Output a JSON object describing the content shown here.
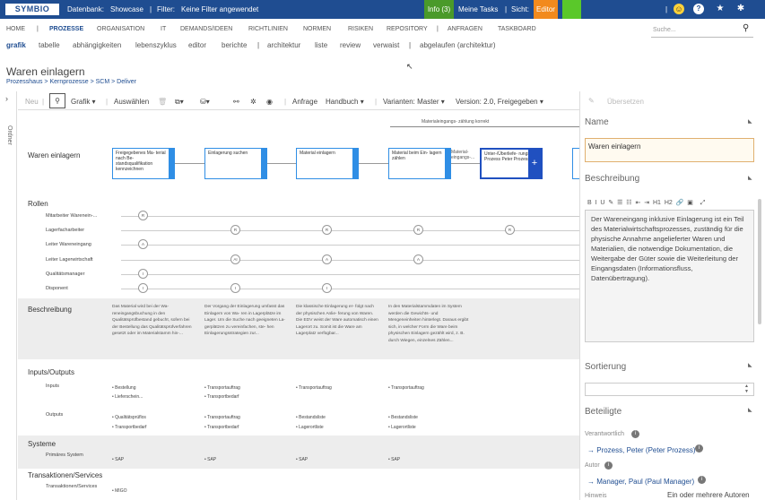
{
  "topbar": {
    "logo": "SYMBIO",
    "db_label": "Datenbank:",
    "db_value": "Showcase",
    "sep1": "|",
    "filter_label": "Filter:",
    "filter_value": "Keine Filter angewendet",
    "info": "Info (3)",
    "tasks": "Meine Tasks",
    "sep2": "|",
    "view_label": "Sicht:",
    "view_value": "Editor",
    "sep3": "|",
    "icons": [
      "smiley-icon",
      "help-icon",
      "star-icon",
      "gear-icon"
    ],
    "colors": {
      "bar": "#1f4d91",
      "info": "#4a9a2a",
      "editor": "#f28a1d",
      "green": "#5ac82a"
    }
  },
  "mainnav": {
    "items": [
      "HOME",
      "|",
      "PROZESSE",
      "ORGANISATION",
      "IT",
      "DEMANDS/IDEEN",
      "RICHTLINIEN",
      "NORMEN",
      "RISIKEN",
      "REPOSITORY",
      "|",
      "ANFRAGEN",
      "TASKBOARD"
    ],
    "search_placeholder": "Suche..."
  },
  "subnav": {
    "items": [
      "grafik",
      "tabelle",
      "abhängigkeiten",
      "lebenszyklus",
      "editor",
      "berichte",
      "|",
      "architektur",
      "liste",
      "review",
      "verwaist",
      "|",
      "abgelaufen (architektur)"
    ]
  },
  "page": {
    "title": "Waren einlagern",
    "breadcrumb": "Prozesshaus > Kernprozesse > SCM > Deliver"
  },
  "leftstrip": {
    "label": "Ordner"
  },
  "toolbar": {
    "new": "Neu",
    "sep1": "|",
    "graphic": "Grafik ▾",
    "sep2": "|",
    "select": "Auswählen",
    "request": "Anfrage",
    "manual": "Handbuch ▾",
    "sep3": "|",
    "variants": "Varianten: Master ▾",
    "version": "Version: 2.0, Freigegeben ▾"
  },
  "diagram": {
    "process_label": "Waren einlagern",
    "top_annotation": "Materialeingangs- zählung korrekt",
    "steps": [
      "Freigegebenes Ma- terial nach Be- standsqualifikation kennzeichnen",
      "Einlagerung suchen",
      "Material einlagern",
      "Material beim Ein- lagern zählen",
      "Unter-/Überliefe- rungs- Prozess Peter Prozess"
    ],
    "arrow_label": "Material- eingangs-...",
    "roles_title": "Rollen",
    "roles": [
      "Mitarbeiter Warenein-...",
      "Lagerfacharbeiter",
      "Leiter Wareneingang",
      "Leiter Lagerwirtschaft",
      "Qualitätsmanager",
      "Disponent"
    ],
    "desc_title": "Beschreibung",
    "descriptions": [
      "Das Material wird bei der Wa- reneingangsbuchung in den Qualitätsprüfbestand gebucht, sofern bei der Bestellung das Qualitätsprüfverfahren gesetzt oder im Materialstamm hin-...",
      "Der Vorgang der Einlagerung umfasst das Einlagern von Wa- ren in Lagerplätze im Lager. Um die Suche nach geeigneten La- gerplätzen zu vereinfachen, ste- hen Einlagerungsstrategien zur...",
      "Die klassische Einlagerung er- folgt nach der physischen Anlie- ferung von Waren. Die EDV weist der Ware automatisch einen Lagerort zu. Somit ist die Ware am Lagerplatz verfügbar...",
      "In den Materialstammdaten im System werden die Gewichts- und Mengeneinheiten hinterlegt. Daraus ergibt sich, in welcher Form die Ware beim physischen Einlagern gezählt wird, z. B. durch Wiegen, einzelnes Zählen..."
    ],
    "io_title": "Inputs/Outputs",
    "inputs_label": "Inputs",
    "outputs_label": "Outputs",
    "inputs": [
      [
        "• Bestellung",
        "• Lieferschein..."
      ],
      [
        "• Transportauftrag",
        "• Transportbedarf"
      ],
      [
        "• Transportauftrag"
      ],
      [
        "• Transportauftrag"
      ]
    ],
    "outputs": [
      [
        "• Qualitätsprüflos",
        "• Transportbedarf"
      ],
      [
        "• Transportauftrag",
        "• Transportbedarf"
      ],
      [
        "• Bestandsliste",
        "• Lagerortliste"
      ],
      [
        "• Bestandsliste",
        "• Lagerortliste"
      ]
    ],
    "systems_title": "Systeme",
    "primary_label": "Primäres System",
    "systems": [
      "• SAP",
      "• SAP",
      "• SAP",
      "• SAP"
    ],
    "trans_title": "Transaktionen/Services",
    "trans_label": "Transaktionen/Services",
    "trans": [
      "• MIGO"
    ]
  },
  "panel": {
    "translate": "Übersetzen",
    "name_h": "Name",
    "name_value": "Waren einlagern",
    "desc_h": "Beschreibung",
    "desc_text": "Der Wareneingang inklusive Einlagerung ist ein Teil des Materialwirtschaftsprozesses, zuständig für die physische Annahme angelieferter Waren und Materialien, die notwendige Dokumentation, die Weitergabe der Güter sowie die Weiterleitung der Eingangsdaten (Informationsfluss, Datenübertragung).",
    "editor_buttons": [
      "B",
      "I",
      "U",
      "✎",
      "☰",
      "☷",
      "⇤",
      "⇥",
      "H1",
      "H2",
      "🔗",
      "▣",
      "⤢"
    ],
    "sort_h": "Sortierung",
    "part_h": "Beteiligte",
    "responsible_label": "Verantwortlich",
    "responsible_value": "Prozess, Peter (Peter Prozess)",
    "author_label": "Autor",
    "author_value": "Manager, Paul (Paul Manager)",
    "hint_label": "Hinweis",
    "hint_value": "Ein oder mehrere Autoren"
  }
}
